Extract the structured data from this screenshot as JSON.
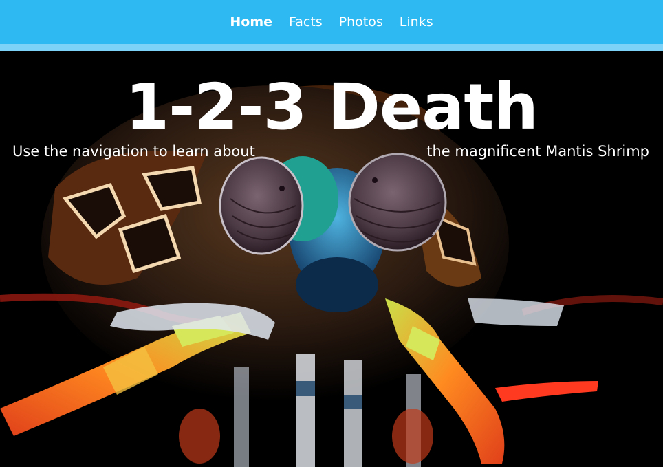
{
  "nav": {
    "items": [
      {
        "label": "Home",
        "active": true
      },
      {
        "label": "Facts",
        "active": false
      },
      {
        "label": "Photos",
        "active": false
      },
      {
        "label": "Links",
        "active": false
      }
    ]
  },
  "hero": {
    "title": "1-2-3 Death",
    "tagline_left": "Use the navigation to learn about",
    "tagline_right": "the magnificent Mantis Shrimp"
  },
  "colors": {
    "nav_background": "#2eb9f2",
    "nav_strip": "#7dd3f7",
    "hero_background": "#000000"
  }
}
